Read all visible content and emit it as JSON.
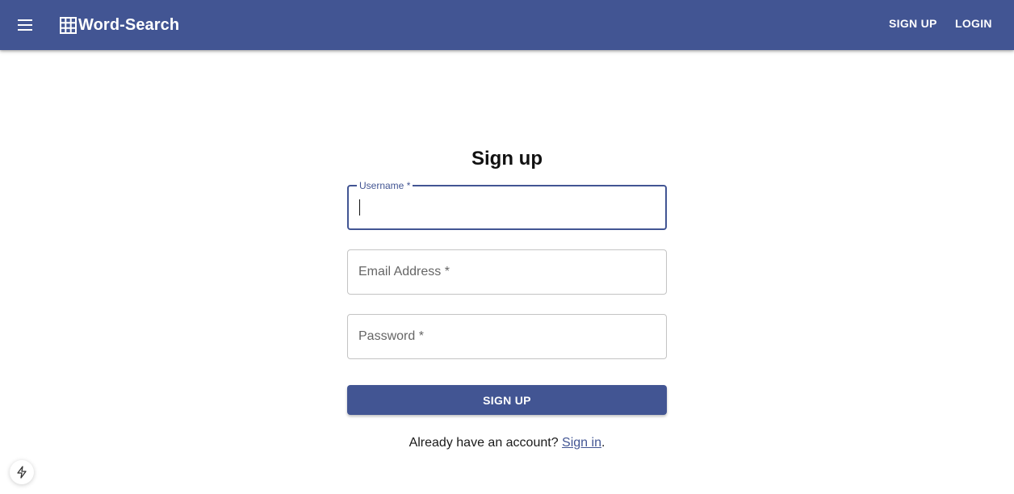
{
  "appbar": {
    "brand": "Word-Search",
    "brand_icon": "grid-icon",
    "menu_icon": "hamburger-menu-icon",
    "nav": {
      "signup": "SIGN UP",
      "login": "LOGIN"
    },
    "color": "#425593"
  },
  "form": {
    "title": "Sign up",
    "username": {
      "label": "Username *",
      "value": ""
    },
    "email": {
      "placeholder": "Email Address *",
      "value": ""
    },
    "password": {
      "placeholder": "Password *",
      "value": ""
    },
    "submit": "SIGN UP",
    "footer_text": "Already have an account?",
    "footer_link": "Sign in",
    "footer_end": "."
  },
  "fab_icon": "lightning-bolt-icon"
}
